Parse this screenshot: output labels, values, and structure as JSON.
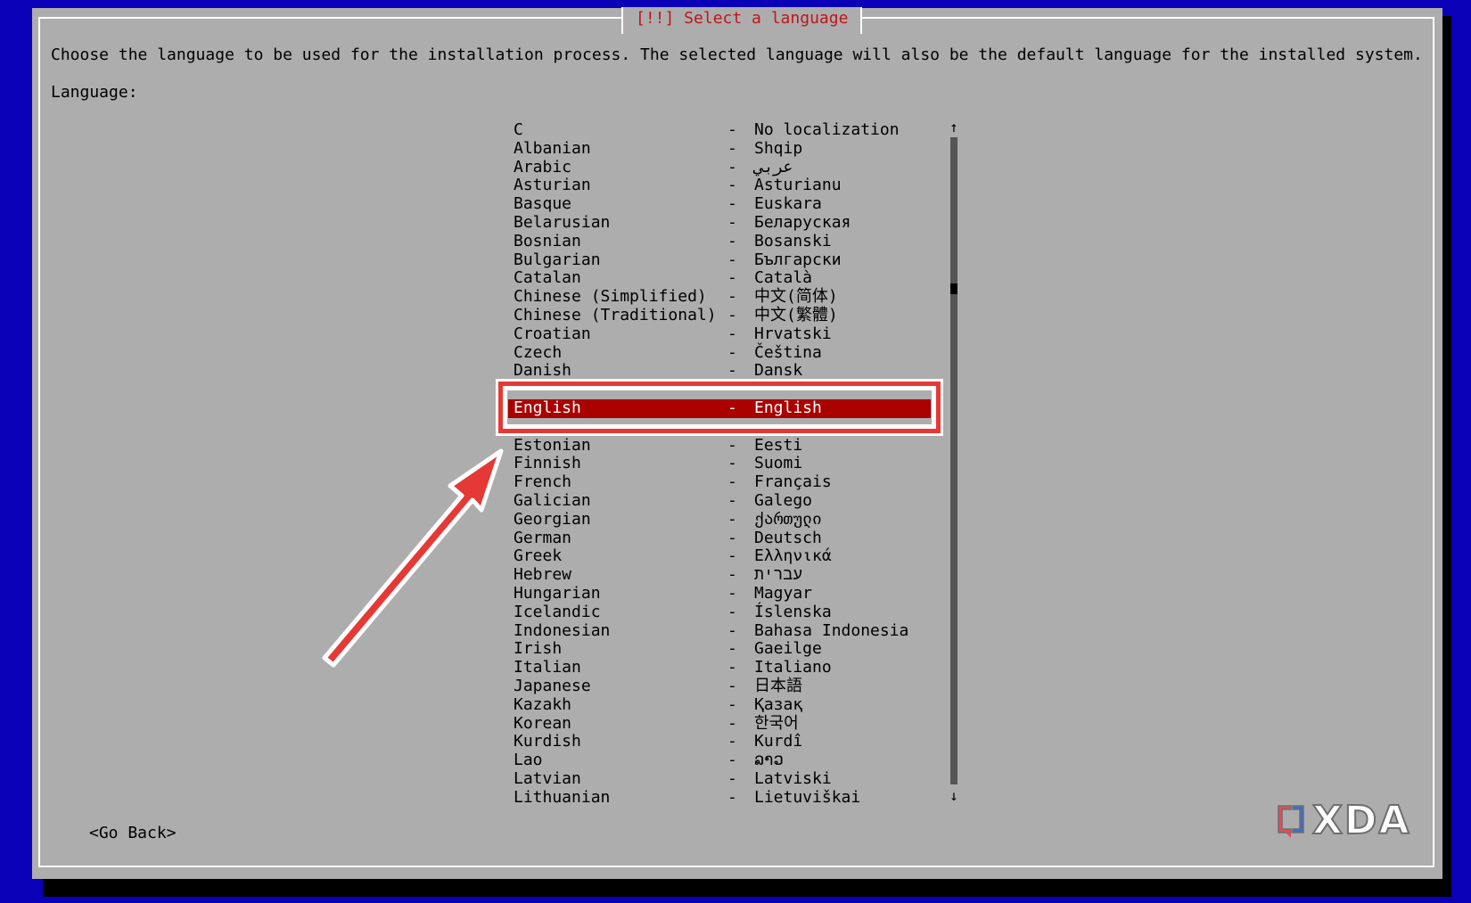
{
  "dialog": {
    "title": "[!!] Select a language",
    "prompt": "Choose the language to be used for the installation process. The selected language will also be the default language for the installed system.",
    "field_label": "Language:",
    "go_back_label": "<Go Back>"
  },
  "languages": [
    {
      "name": "C",
      "native": "No localization"
    },
    {
      "name": "Albanian",
      "native": "Shqip"
    },
    {
      "name": "Arabic",
      "native": "عربي"
    },
    {
      "name": "Asturian",
      "native": "Asturianu"
    },
    {
      "name": "Basque",
      "native": "Euskara"
    },
    {
      "name": "Belarusian",
      "native": "Беларуская"
    },
    {
      "name": "Bosnian",
      "native": "Bosanski"
    },
    {
      "name": "Bulgarian",
      "native": "Български"
    },
    {
      "name": "Catalan",
      "native": "Català"
    },
    {
      "name": "Chinese (Simplified)",
      "native": "中文(简体)"
    },
    {
      "name": "Chinese (Traditional)",
      "native": "中文(繁體)"
    },
    {
      "name": "Croatian",
      "native": "Hrvatski"
    },
    {
      "name": "Czech",
      "native": "Čeština"
    },
    {
      "name": "Danish",
      "native": "Dansk"
    },
    {
      "name": "",
      "native": ""
    },
    {
      "name": "English",
      "native": "English"
    },
    {
      "name": "",
      "native": ""
    },
    {
      "name": "Estonian",
      "native": "Eesti"
    },
    {
      "name": "Finnish",
      "native": "Suomi"
    },
    {
      "name": "French",
      "native": "Français"
    },
    {
      "name": "Galician",
      "native": "Galego"
    },
    {
      "name": "Georgian",
      "native": "ქართული"
    },
    {
      "name": "German",
      "native": "Deutsch"
    },
    {
      "name": "Greek",
      "native": "Ελληνικά"
    },
    {
      "name": "Hebrew",
      "native": "עברית"
    },
    {
      "name": "Hungarian",
      "native": "Magyar"
    },
    {
      "name": "Icelandic",
      "native": "Íslenska"
    },
    {
      "name": "Indonesian",
      "native": "Bahasa Indonesia"
    },
    {
      "name": "Irish",
      "native": "Gaeilge"
    },
    {
      "name": "Italian",
      "native": "Italiano"
    },
    {
      "name": "Japanese",
      "native": "日本語"
    },
    {
      "name": "Kazakh",
      "native": "Қазақ"
    },
    {
      "name": "Korean",
      "native": "한국어"
    },
    {
      "name": "Kurdish",
      "native": "Kurdî"
    },
    {
      "name": "Lao",
      "native": "ລາວ"
    },
    {
      "name": "Latvian",
      "native": "Latviski"
    },
    {
      "name": "Lithuanian",
      "native": "Lietuviškai"
    }
  ],
  "separator": "-",
  "selected_index": 15,
  "scroll_fraction": 0.23,
  "watermark": "XDA",
  "colors": {
    "background": "#0a00b8",
    "dialog": "#adadad",
    "title_text": "#c0141a",
    "selection": "#aa0000",
    "annotation": "#e53935"
  }
}
